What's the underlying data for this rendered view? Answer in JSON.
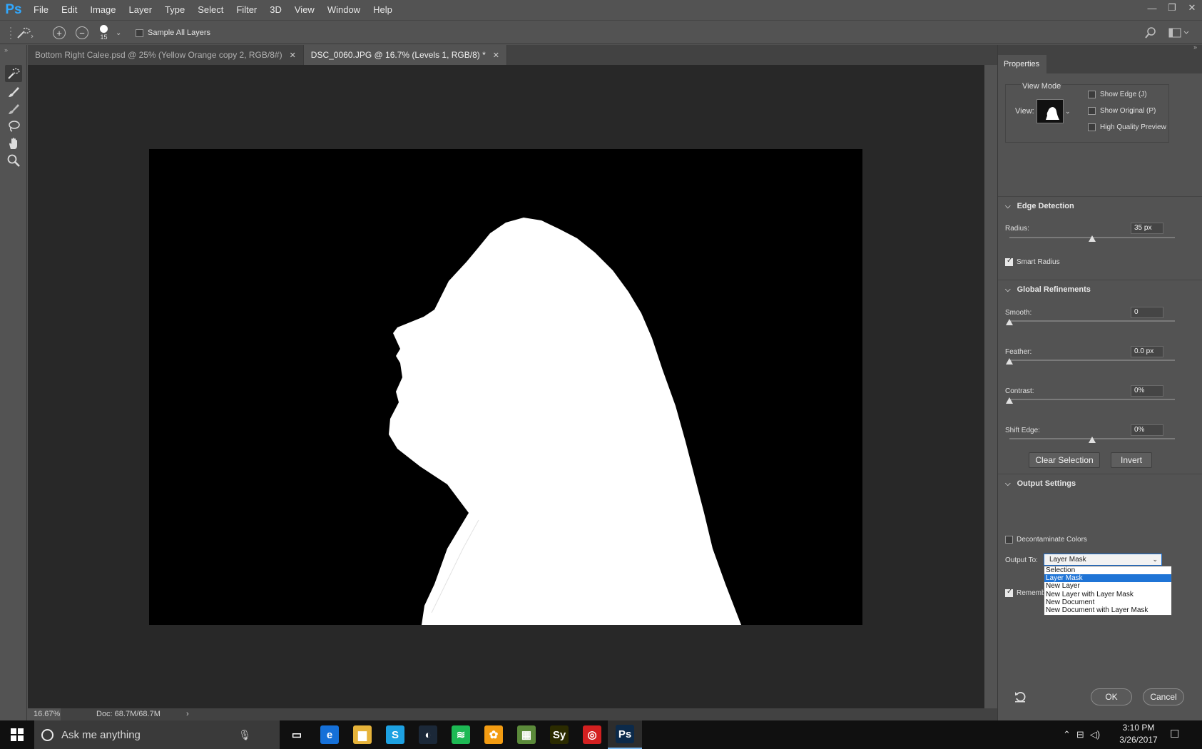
{
  "app": {
    "logo": "Ps"
  },
  "menu": [
    "File",
    "Edit",
    "Image",
    "Layer",
    "Type",
    "Select",
    "Filter",
    "3D",
    "View",
    "Window",
    "Help"
  ],
  "options": {
    "brush_size": "15",
    "sample_all_layers": "Sample All Layers",
    "sample_all_layers_checked": false
  },
  "tabs": [
    {
      "label": "Bottom Right Calee.psd @ 25% (Yellow Orange copy 2, RGB/8#)",
      "active": false
    },
    {
      "label": "DSC_0060.JPG @ 16.7% (Levels 1, RGB/8) *",
      "active": true
    }
  ],
  "status": {
    "zoom": "16.67%",
    "doc": "Doc: 68.7M/68.7M"
  },
  "properties": {
    "tab_title": "Properties",
    "view_mode": {
      "title": "View Mode",
      "view_label": "View:",
      "show_edge": "Show Edge (J)",
      "show_original": "Show Original (P)",
      "high_quality": "High Quality Preview"
    },
    "edge_detection": {
      "title": "Edge Detection",
      "radius_label": "Radius:",
      "radius_value": "35 px",
      "radius_fraction": 0.5,
      "smart_radius": "Smart Radius",
      "smart_radius_checked": true
    },
    "global_refinements": {
      "title": "Global Refinements",
      "smooth_label": "Smooth:",
      "smooth_value": "0",
      "smooth_fraction": 0.0,
      "feather_label": "Feather:",
      "feather_value": "0.0 px",
      "feather_fraction": 0.0,
      "contrast_label": "Contrast:",
      "contrast_value": "0%",
      "contrast_fraction": 0.0,
      "shift_label": "Shift Edge:",
      "shift_value": "0%",
      "shift_fraction": 0.5,
      "clear_selection": "Clear Selection",
      "invert": "Invert"
    },
    "output": {
      "title": "Output Settings",
      "decontaminate": "Decontaminate Colors",
      "output_to_label": "Output To:",
      "output_to_value": "Layer Mask",
      "options": [
        "Selection",
        "Layer Mask",
        "New Layer",
        "New Layer with Layer Mask",
        "New Document",
        "New Document with Layer Mask"
      ],
      "selected_index": 1,
      "remember": "Rememb"
    },
    "ok": "OK",
    "cancel": "Cancel"
  },
  "taskbar": {
    "search_placeholder": "Ask me anything",
    "time": "3:10 PM",
    "date": "3/26/2017",
    "apps": [
      {
        "name": "task-view-icon",
        "glyph": "▭",
        "color": "#101010"
      },
      {
        "name": "edge-icon",
        "glyph": "e",
        "color": "#1570d8"
      },
      {
        "name": "file-explorer-icon",
        "glyph": "▆",
        "color": "#e6b33a"
      },
      {
        "name": "skype-icon",
        "glyph": "S",
        "color": "#1da1e2"
      },
      {
        "name": "steam-icon",
        "glyph": "◐",
        "color": "#1b2838"
      },
      {
        "name": "spotify-icon",
        "glyph": "≋",
        "color": "#1db954"
      },
      {
        "name": "fl-studio-icon",
        "glyph": "✿",
        "color": "#f39c12"
      },
      {
        "name": "minecraft-icon",
        "glyph": "▦",
        "color": "#5b8a3a"
      },
      {
        "name": "sy-app-icon",
        "glyph": "Sy",
        "color": "#2b2b00"
      },
      {
        "name": "creative-cloud-icon",
        "glyph": "◎",
        "color": "#d32020"
      },
      {
        "name": "photoshop-taskbar-icon",
        "glyph": "Ps",
        "color": "#0c2a4a"
      }
    ]
  }
}
